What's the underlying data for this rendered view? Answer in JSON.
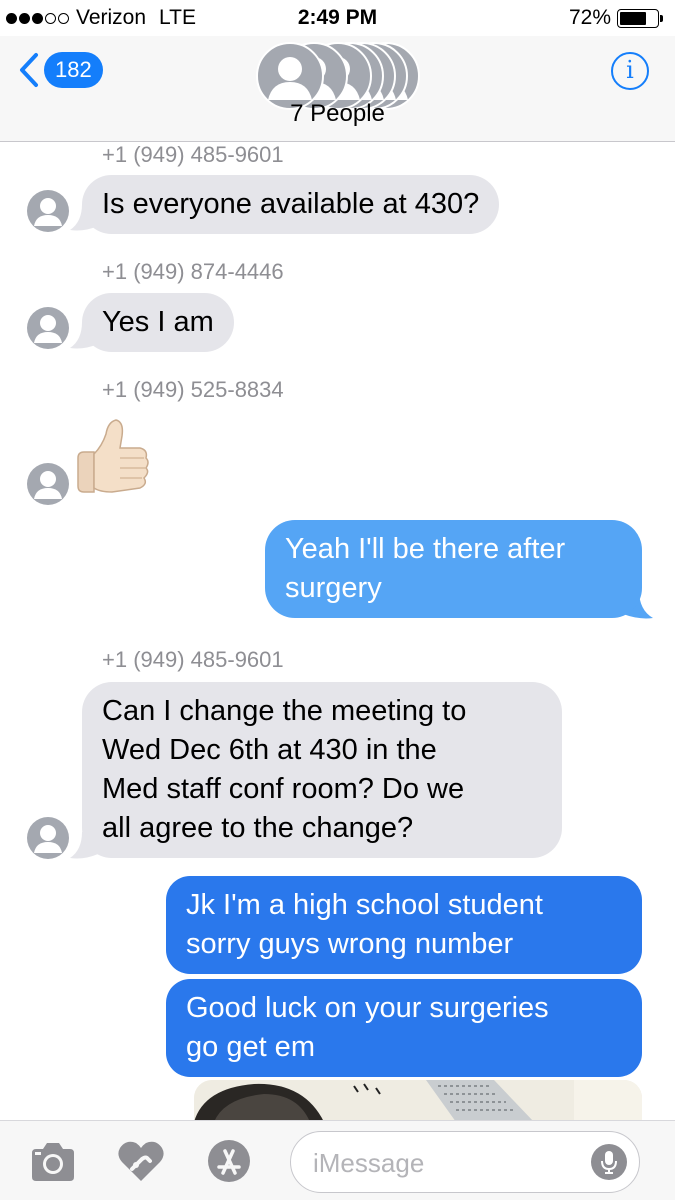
{
  "status_bar": {
    "signal_filled": 3,
    "signal_total": 5,
    "carrier": "Verizon",
    "network": "LTE",
    "time": "2:49 PM",
    "battery_percent": "72%",
    "battery_level": 0.72
  },
  "header": {
    "back_count": "182",
    "title": "7 People",
    "info_label": "i",
    "avatar_count": 7
  },
  "messages": [
    {
      "sender": "+1 (949) 485-9601",
      "text": "Is everyone available at 430?"
    },
    {
      "sender": "+1 (949) 874-4446",
      "text": "Yes I am"
    },
    {
      "sender": "+1 (949) 525-8834",
      "emoji": "thumbs-up-light-skin-tone"
    },
    {
      "from_me": true,
      "line1": "Yeah I'll be there after",
      "line2": "surgery"
    },
    {
      "sender": "+1 (949) 485-9601",
      "line1": "Can I change the meeting to",
      "line2": "Wed Dec 6th at 430 in the",
      "line3": "Med staff conf room? Do we",
      "line4": "all agree to the  change?"
    },
    {
      "from_me": true,
      "line1": "Jk I'm a high school student",
      "line2": "sorry guys wrong number"
    },
    {
      "from_me": true,
      "line1": "Good luck on your surgeries",
      "line2": "go get em"
    }
  ],
  "input_bar": {
    "placeholder": "iMessage",
    "icons": [
      "camera-icon",
      "digital-touch-heart-icon",
      "app-store-icon",
      "microphone-icon"
    ]
  },
  "colors": {
    "accent": "#147efb",
    "incoming_bubble": "#e5e5ea",
    "outgoing_sms_bubble": "#55a5f5",
    "outgoing_imessage_bubble": "#2a78ec",
    "secondary_text": "#8e8e93"
  }
}
